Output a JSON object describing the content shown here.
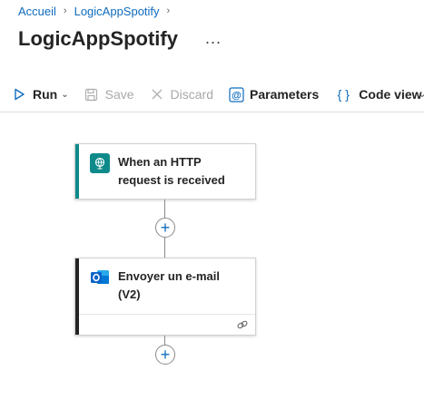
{
  "breadcrumb": {
    "items": [
      "Accueil",
      "LogicAppSpotify"
    ]
  },
  "page": {
    "title": "LogicAppSpotify",
    "more_label": "..."
  },
  "toolbar": {
    "run_label": "Run",
    "save_label": "Save",
    "discard_label": "Discard",
    "parameters_label": "Parameters",
    "code_view_label": "Code view",
    "parameters_icon_text": "@",
    "code_view_icon_text": "{ }"
  },
  "workflow": {
    "trigger": {
      "title": "When an HTTP request is received",
      "accent_color": "#0e8a8a",
      "icon": "http-trigger-icon"
    },
    "action": {
      "title": "Envoyer un e-mail (V2)",
      "accent_color": "#242424",
      "icon": "outlook-icon",
      "footer_icon": "connection-link-icon"
    },
    "add_step_label": "+"
  },
  "colors": {
    "accent_blue": "#0f6cbd",
    "trigger_teal": "#0e8a8a",
    "outlook_blue": "#0a64c8"
  }
}
